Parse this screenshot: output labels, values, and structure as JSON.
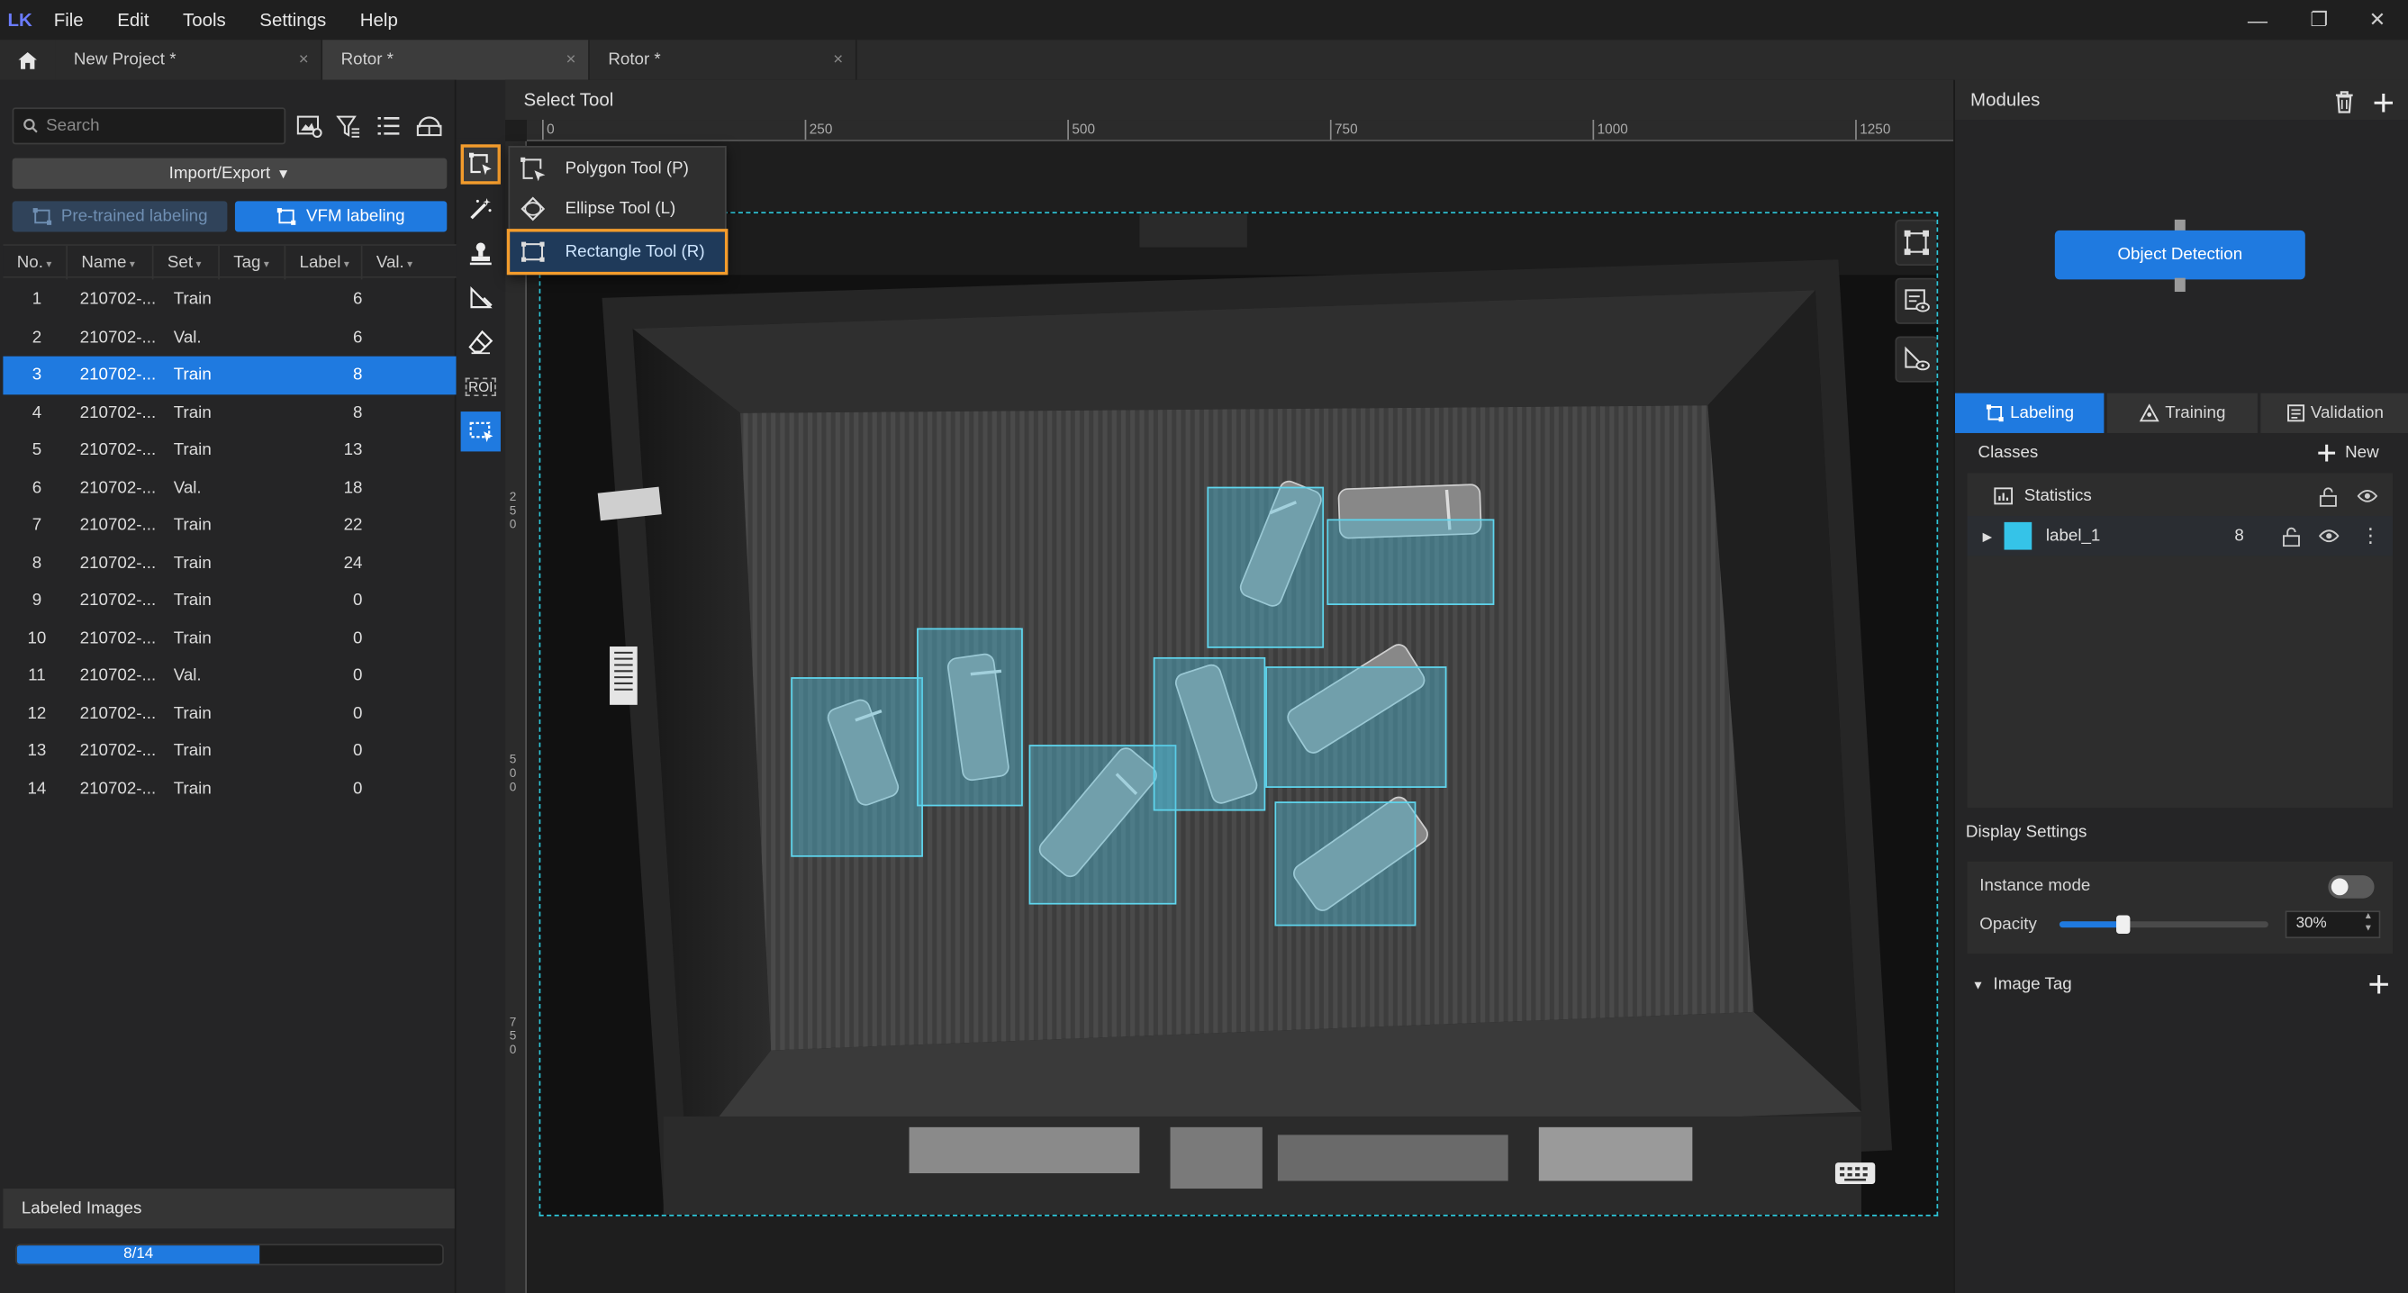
{
  "app": {
    "logo": "LK",
    "brand_color": "#6b7cff",
    "accent": "#1f7ae0",
    "highlight": "#f39c2c"
  },
  "menu": [
    "File",
    "Edit",
    "Tools",
    "Settings",
    "Help"
  ],
  "window_controls": {
    "minimize": "—",
    "restore": "❐",
    "close": "✕"
  },
  "tabs": [
    {
      "label": "New Project *",
      "close": "×"
    },
    {
      "label": "Rotor *",
      "close": "×",
      "active": true
    },
    {
      "label": "Rotor *",
      "close": "×"
    }
  ],
  "left": {
    "search_placeholder": "Search",
    "import_export": "Import/Export",
    "pretrained": "Pre-trained labeling",
    "vfm": "VFM labeling",
    "columns": [
      "No.",
      "Name",
      "Set",
      "Tag",
      "Label",
      "Val."
    ],
    "rows": [
      {
        "no": "1",
        "name": "210702-...",
        "set": "Train",
        "label": "6"
      },
      {
        "no": "2",
        "name": "210702-...",
        "set": "Val.",
        "label": "6"
      },
      {
        "no": "3",
        "name": "210702-...",
        "set": "Train",
        "label": "8",
        "selected": true
      },
      {
        "no": "4",
        "name": "210702-...",
        "set": "Train",
        "label": "8"
      },
      {
        "no": "5",
        "name": "210702-...",
        "set": "Train",
        "label": "13"
      },
      {
        "no": "6",
        "name": "210702-...",
        "set": "Val.",
        "label": "18"
      },
      {
        "no": "7",
        "name": "210702-...",
        "set": "Train",
        "label": "22"
      },
      {
        "no": "8",
        "name": "210702-...",
        "set": "Train",
        "label": "24"
      },
      {
        "no": "9",
        "name": "210702-...",
        "set": "Train",
        "label": "0"
      },
      {
        "no": "10",
        "name": "210702-...",
        "set": "Train",
        "label": "0"
      },
      {
        "no": "11",
        "name": "210702-...",
        "set": "Val.",
        "label": "0"
      },
      {
        "no": "12",
        "name": "210702-...",
        "set": "Train",
        "label": "0"
      },
      {
        "no": "13",
        "name": "210702-...",
        "set": "Train",
        "label": "0"
      },
      {
        "no": "14",
        "name": "210702-...",
        "set": "Train",
        "label": "0"
      }
    ],
    "labeled_images_title": "Labeled Images",
    "progress_text": "8/14",
    "progress_fraction": 0.5714
  },
  "tools": {
    "roi": "ROI"
  },
  "canvas": {
    "title": "Select Tool",
    "ruler_top": [
      "0",
      "250",
      "500",
      "750",
      "1000",
      "1250"
    ],
    "ruler_left": [
      [
        "2",
        "5",
        "0"
      ],
      [
        "5",
        "0",
        "0"
      ],
      [
        "7",
        "5",
        "0"
      ]
    ]
  },
  "dropdown": [
    {
      "label": "Polygon Tool (P)",
      "icon": "polygon-icon"
    },
    {
      "label": "Ellipse Tool (L)",
      "icon": "ellipse-icon"
    },
    {
      "label": "Rectangle Tool (R)",
      "icon": "rectangle-icon",
      "highlighted": true
    }
  ],
  "right": {
    "modules_title": "Modules",
    "module_node": "Object Detection",
    "tabs": [
      "Labeling",
      "Training",
      "Validation"
    ],
    "classes_title": "Classes",
    "new_label": "New",
    "statistics": "Statistics",
    "class": {
      "name": "label_1",
      "count": "8",
      "color": "#35c3e8"
    },
    "display_settings": "Display Settings",
    "instance_mode": "Instance mode",
    "instance_mode_on": false,
    "opacity_label": "Opacity",
    "opacity_value": "30%",
    "opacity_fraction": 0.3,
    "image_tag": "Image Tag"
  }
}
